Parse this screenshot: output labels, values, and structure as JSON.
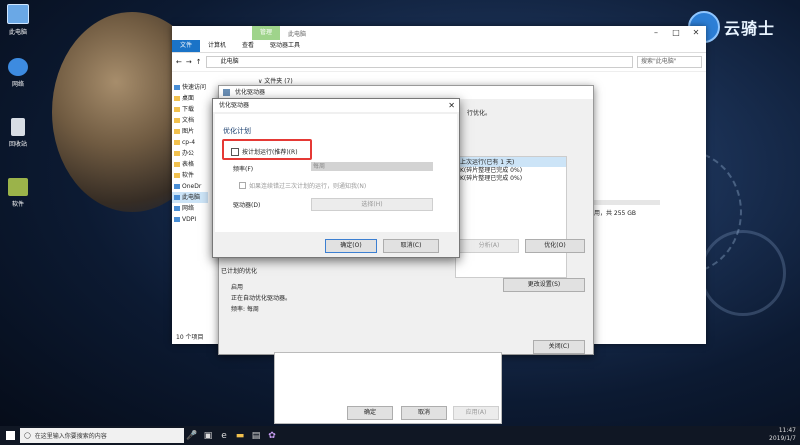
{
  "desktop": {
    "icons": [
      {
        "label": "此电脑",
        "icon": "computer-icon"
      },
      {
        "label": "网络",
        "icon": "network-icon"
      },
      {
        "label": "回收站",
        "icon": "recycle-bin-icon"
      },
      {
        "label": "软件",
        "icon": "folder-icon"
      }
    ],
    "watermark": "云骑士"
  },
  "explorer": {
    "title": "此电脑",
    "ribbon_context": "管理",
    "tabs": [
      "文件",
      "计算机",
      "查看",
      "驱动器工具"
    ],
    "address": "此电脑",
    "search_placeholder": "搜索\"此电脑\"",
    "nav_items": [
      "快速访问",
      "桌面",
      "下载",
      "文档",
      "图片",
      "cp-4",
      "办公",
      "表格",
      "软件",
      "OneDr",
      "此电脑",
      "网络",
      "VDPI"
    ],
    "section_header": "∨ 文件夹 (7)",
    "status": "10 个项目",
    "capacity_text": "可用，共 255 GB"
  },
  "optimize_window": {
    "title": "优化驱动器",
    "desc_fragment": "行优化。",
    "status_lines": [
      "上次运行(已有 1 天)",
      "K(碎片整理已完成 0%)",
      "K(碎片整理已完成 0%)"
    ],
    "analyze_button": "分析(A)",
    "optimize_button": "优化(O)",
    "scheduled_header": "已计划的优化",
    "on_label": "启用",
    "running_text": "正在自动优化驱动器。",
    "frequency_text": "频率: 每周",
    "change_settings_button": "更改设置(S)",
    "close_button": "关闭(C)"
  },
  "schedule_dialog": {
    "title": "优化驱动器",
    "section_title": "优化计划",
    "run_on_schedule": "按计划运行(推荐)(R)",
    "frequency_label": "频率(F)",
    "frequency_value": "每周",
    "notify_text": "如果连续错过三次计划的运行，则通知我(N)",
    "drives_label": "驱动器(D)",
    "choose_button": "选择(H)",
    "ok_button": "确定(O)",
    "cancel_button": "取消(C)"
  },
  "bottom_window": {
    "ok_button": "确定",
    "cancel_button": "取消",
    "apply_button": "应用(A)"
  },
  "taskbar": {
    "search_placeholder": "在这里输入你要搜索的内容",
    "time": "11:47",
    "date": "2019/1/7"
  },
  "colors": {
    "accent": "#1a73c7",
    "highlight": "#e53935"
  }
}
